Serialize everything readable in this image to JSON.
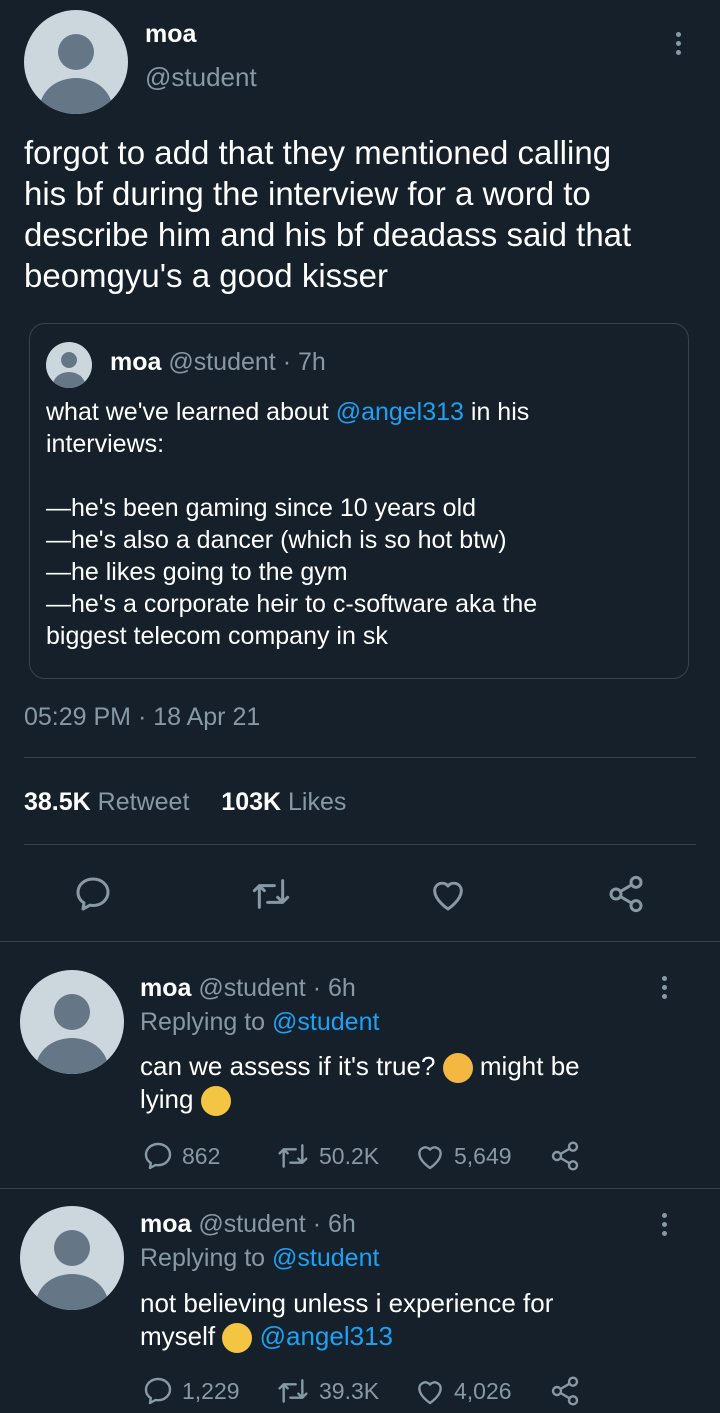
{
  "main_tweet": {
    "display_name": "moa",
    "handle": "@student",
    "text_lines": [
      "forgot to add that they mentioned calling",
      "his bf during the interview for a word to",
      "describe him and his bf deadass said that",
      "beomgyu's a good kisser"
    ],
    "quote": {
      "display_name": "moa",
      "handle": "@student",
      "time": "· 7h",
      "line1_prefix": "what we've learned about ",
      "line1_mention": "@angel313",
      "line1_suffix": " in his",
      "lines": [
        "interviews:",
        "",
        "—he's been gaming since 10 years old",
        "—he's also a dancer (which is so hot btw)",
        "—he likes going to the gym",
        "—he's a corporate heir to c-software aka the",
        "biggest telecom company in sk"
      ]
    },
    "timestamp": "05:29 PM · 18 Apr 21",
    "retweet_count": "38.5K",
    "retweet_label": "Retweet",
    "likes_count": "103K",
    "likes_label": "Likes"
  },
  "replies": [
    {
      "display_name": "moa",
      "handle": "@student",
      "time": "· 6h",
      "replying_label": "Replying to",
      "replying_handle": "@student",
      "line1": "can we assess if it's true?",
      "line1_after": "might be",
      "line2": "lying",
      "reply_count": "862",
      "retweet_count": "50.2K",
      "like_count": "5,649"
    },
    {
      "display_name": "moa",
      "handle": "@student",
      "time": "· 6h",
      "replying_label": "Replying to",
      "replying_handle": "@student",
      "line1": "not believing unless i experience for",
      "line2": "myself",
      "line2_mention": "@angel313",
      "reply_count": "1,229",
      "retweet_count": "39.3K",
      "like_count": "4,026"
    }
  ],
  "icons": [
    "reply-icon",
    "retweet-icon",
    "like-icon",
    "share-icon",
    "more-icon"
  ],
  "colors": {
    "background": "#15202b",
    "accent": "#1da1f2",
    "secondary_text": "#8899a6",
    "divider": "#38444d"
  }
}
